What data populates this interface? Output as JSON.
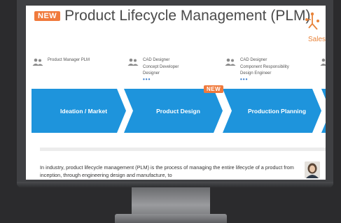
{
  "header": {
    "badge": "NEW",
    "title": "Product Lifecycle Management (PLM)"
  },
  "side_panel": {
    "label": "Sales"
  },
  "roles": [
    {
      "lines": [
        "Product Manager PLM"
      ],
      "has_more": false
    },
    {
      "lines": [
        "CAD Designer",
        "Concept Developer",
        "Designer"
      ],
      "has_more": true
    },
    {
      "lines": [
        "CAD Designer",
        "Component Responsibility",
        "Design Engineer"
      ],
      "has_more": true
    }
  ],
  "more_indicator": "•••",
  "process": {
    "steps": [
      {
        "label": "Ideation / Market"
      },
      {
        "label": "Product Design"
      },
      {
        "label": "Production Planning"
      },
      {
        "label": ""
      }
    ],
    "new_tag": "NEW"
  },
  "description": "In industry, product lifecycle management (PLM) is the process of managing the entire lifecycle of a product from inception, through engineering design and manufacture, to",
  "colors": {
    "accent": "#1e94dc",
    "badge": "#f07a3c",
    "background": "#2b2b2d",
    "bezel": "#3f4043"
  }
}
